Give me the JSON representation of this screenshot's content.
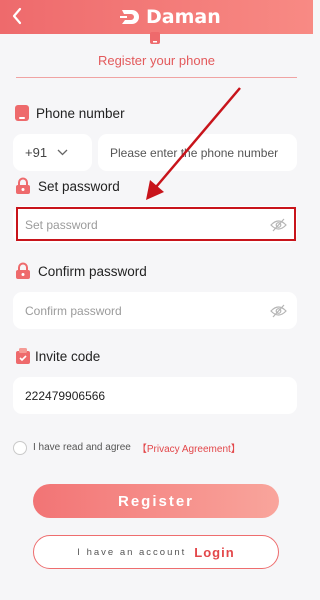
{
  "header": {
    "brand": "Daman"
  },
  "page_title": "Register your phone",
  "phone": {
    "label": "Phone number",
    "country_code": "+91",
    "placeholder": "Please enter the phone number"
  },
  "password": {
    "label": "Set password",
    "placeholder": "Set password"
  },
  "confirm": {
    "label": "Confirm password",
    "placeholder": "Confirm password"
  },
  "invite": {
    "label": "Invite code",
    "value": "222479906566"
  },
  "agreement": {
    "text": "I have read and agree",
    "link": "【Privacy Agreement】"
  },
  "buttons": {
    "register": "Register",
    "have_account": "I have an account",
    "login": "Login"
  },
  "colors": {
    "accent": "#ee6a6c",
    "annotation": "#c8141b"
  },
  "icons": [
    "back-arrow-icon",
    "daman-logo-icon",
    "phone-icon",
    "lock-icon",
    "eye-off-icon",
    "invite-icon",
    "chevron-down-icon"
  ]
}
